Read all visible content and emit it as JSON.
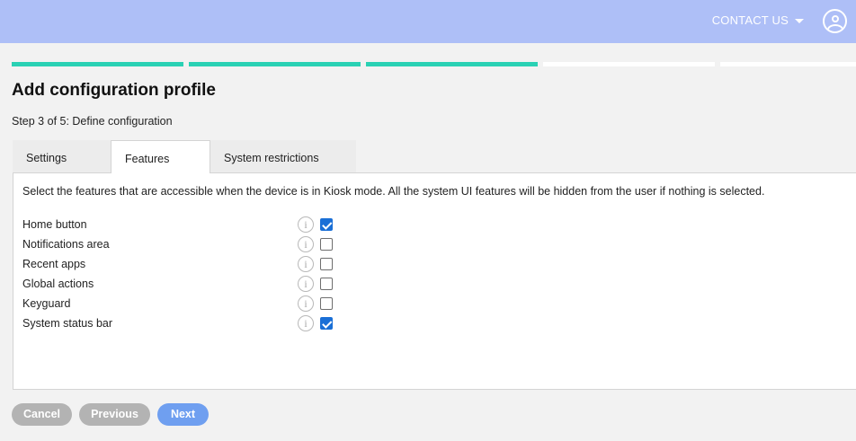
{
  "header": {
    "contact_label": "CONTACT US",
    "icons": [
      "chevron-down-icon",
      "user-avatar-icon"
    ]
  },
  "progress": {
    "total_steps": 5,
    "completed_steps": 3,
    "accent_color": "#2ad1b4"
  },
  "page": {
    "title": "Add configuration profile",
    "step_text": "Step 3 of 5: Define configuration"
  },
  "tabs": [
    {
      "label": "Settings",
      "active": false
    },
    {
      "label": "Features",
      "active": true
    },
    {
      "label": "System restrictions",
      "active": false
    }
  ],
  "panel": {
    "description": "Select the features that are accessible when the device is in Kiosk mode. All the system UI features will be hidden from the user if nothing is selected.",
    "features": [
      {
        "label": "Home button",
        "checked": true
      },
      {
        "label": "Notifications area",
        "checked": false
      },
      {
        "label": "Recent apps",
        "checked": false
      },
      {
        "label": "Global actions",
        "checked": false
      },
      {
        "label": "Keyguard",
        "checked": false
      },
      {
        "label": "System status bar",
        "checked": true
      }
    ],
    "info_icon_glyph": "i"
  },
  "footer": {
    "cancel_label": "Cancel",
    "previous_label": "Previous",
    "next_label": "Next"
  },
  "colors": {
    "header_bg": "#aebff7",
    "checkbox_checked": "#1a6fd6",
    "next_button": "#6f9ff0",
    "disabled_button": "#b3b3b3"
  }
}
